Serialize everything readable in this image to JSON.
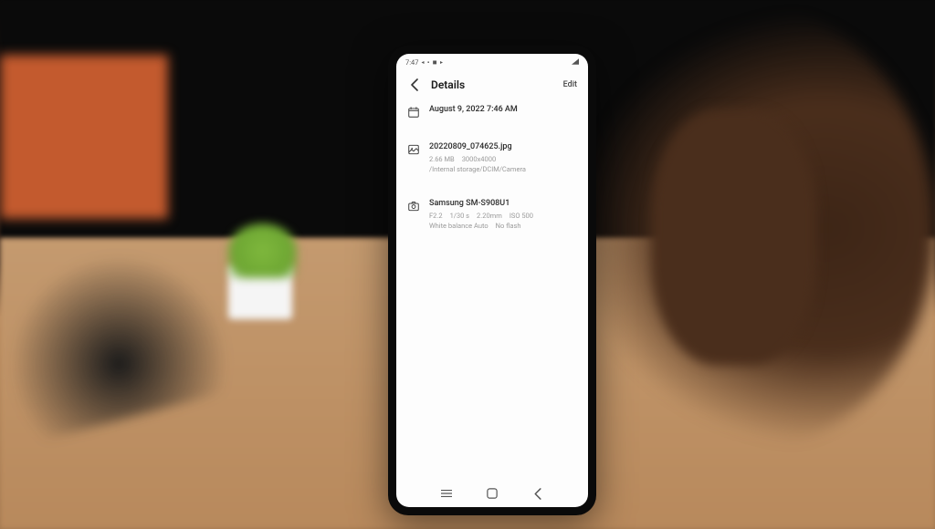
{
  "status": {
    "time": "7:47",
    "icons": "◂▪◼▸"
  },
  "header": {
    "title": "Details",
    "edit_label": "Edit"
  },
  "date_section": {
    "date_time": "August 9, 2022 7:46 AM"
  },
  "file_section": {
    "filename": "20220809_074625.jpg",
    "size": "2.66 MB",
    "dimensions": "3000x4000",
    "path": "/Internal storage/DCIM/Camera"
  },
  "camera_section": {
    "device": "Samsung SM-S908U1",
    "aperture": "F2.2",
    "shutter": "1/30 s",
    "focal": "2.20mm",
    "iso": "ISO 500",
    "wb": "White balance Auto",
    "flash": "No flash"
  }
}
